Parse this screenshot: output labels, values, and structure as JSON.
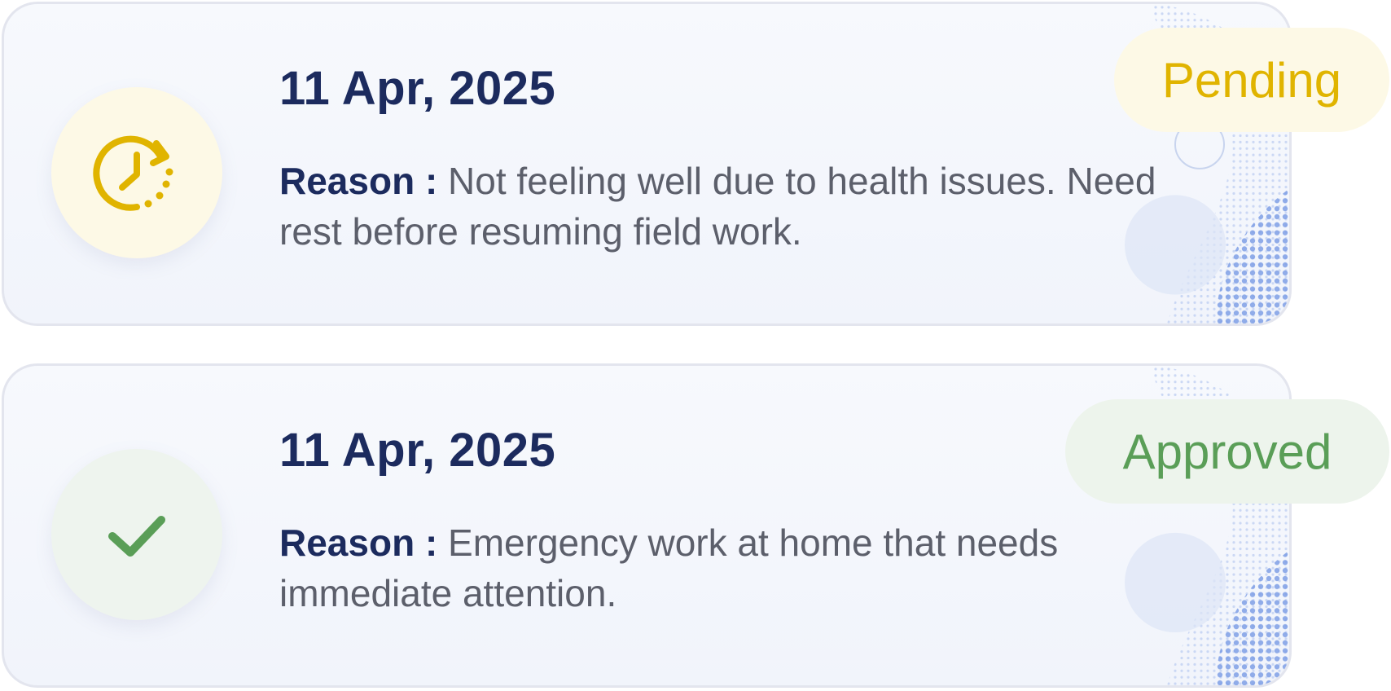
{
  "requests": [
    {
      "date": "11 Apr, 2025",
      "reason_label": "Reason :",
      "reason_text": " Not feeling well due to health issues. Need rest before resuming field work.",
      "status": "Pending",
      "status_icon": "clock-rotate-icon",
      "status_color": "#e0b400"
    },
    {
      "date": "11 Apr, 2025",
      "reason_label": "Reason :",
      "reason_text": " Emergency work at home that needs immediate attention.",
      "status": "Approved",
      "status_icon": "check-icon",
      "status_color": "#5a9e57"
    }
  ]
}
